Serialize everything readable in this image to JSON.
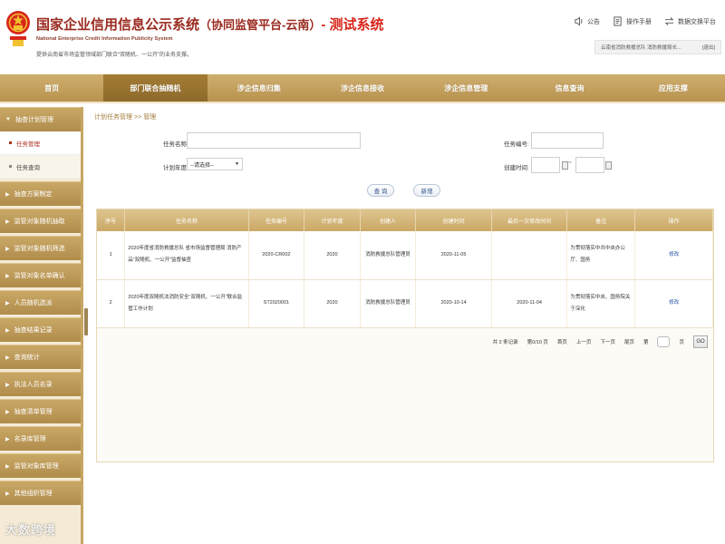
{
  "header": {
    "title": "国家企业信用信息公示系统",
    "title_paren": "（协同监管平台-云南）",
    "title_test": "- 测试系统",
    "subtitle_en": "National Enterprise Credit Information Publicity System",
    "subtitle_cn": "提供云南省市场监管领域部门联合“双随机、一公开”的业务支撑。",
    "links": [
      {
        "label": "公告",
        "icon": "speaker-icon"
      },
      {
        "label": "操作手册",
        "icon": "document-icon"
      },
      {
        "label": "数据交换平台",
        "icon": "exchange-icon"
      }
    ],
    "user_text": "云南省消防救援总队 消防救援局长...",
    "logout_label": "[退出]"
  },
  "nav": {
    "items": [
      "首页",
      "部门联合抽随机",
      "涉企信息归集",
      "涉企信息接收",
      "涉企信息管理",
      "信息查询",
      "应用支撑"
    ],
    "active_index": 1
  },
  "sidebar": {
    "group_open": "抽查计划管理",
    "subitems": [
      "任务管理",
      "任务查询"
    ],
    "groups": [
      "抽查方案制定",
      "监管对象随机抽取",
      "监管对象随机筛选",
      "监管对象名单确认",
      "人员随机选派",
      "抽查结果记录",
      "查询统计",
      "执法人员名录",
      "抽查清单管理",
      "名录库管理",
      "监管对象库管理",
      "其他组织管理"
    ]
  },
  "breadcrumb": {
    "root": "计划任务管理",
    "sep": ">>",
    "current": "管理"
  },
  "form": {
    "task_name_label": "任务名称:",
    "task_no_label": "任务编号:",
    "plan_year_label": "计划年度:",
    "plan_year_value": "--请选择--",
    "create_time_label": "创建时间:",
    "date_sep": "~",
    "query_button": "查 询",
    "add_button": "新增"
  },
  "table": {
    "headers": [
      "序号",
      "任务名称",
      "任务编号",
      "计划年度",
      "创建人",
      "创建时间",
      "最后一次修改时间",
      "备注",
      "操作"
    ],
    "rows": [
      [
        "1",
        "2020年度省消防救援总队 省市场监督管理局 消防产品“双随机、一公开”监督抽查",
        "2020-CR002",
        "2020",
        "消防救援总队管理员",
        "2020-11-05",
        "",
        "为贯彻落实中共中央办公厅、国务",
        "修改"
      ],
      [
        "2",
        "2020年度双随机法消防安全“双随机、一公开”联合监管工作计划",
        "ST2020001",
        "2020",
        "消防救援总队管理员",
        "2020-10-14",
        "2020-11-04",
        "为贯彻落实中央、国务院关于深化",
        "修改"
      ]
    ]
  },
  "pager": {
    "summary": "共 2 条记录",
    "page_info": "第0/10 页",
    "first": "首页",
    "prev": "上一页",
    "next": "下一页",
    "last": "尾页",
    "goto_prefix": "第",
    "goto_suffix": "页",
    "go_label": "GO"
  },
  "watermark": "大数跨境"
}
